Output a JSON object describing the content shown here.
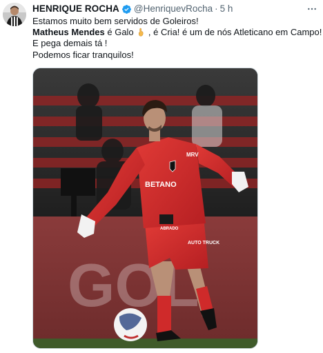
{
  "tweet": {
    "author_name": "HENRIQUE ROCHA",
    "handle": "@HenriquevRocha",
    "separator": "·",
    "time": "5 h",
    "more_label": "···",
    "text": {
      "line1": "Estamos muito bem servidos de Goleiros!",
      "line2_bold": "Matheus Mendes",
      "line2_a": " é Galo ",
      "line2_b": " , é Cria! é um de nós Atleticano em Campo!",
      "line3": "E pega demais tá !",
      "line4": "Podemos ficar tranquilos!"
    },
    "media": {
      "jersey_sponsor": "BETANO",
      "sleeve_sponsor": "MRV",
      "shorts_text": "AUTO TRUCK",
      "board_text": "GOL",
      "small_badge": "ABRADO"
    },
    "colors": {
      "verified": "#1d9bf0",
      "secondary_text": "#536471",
      "kit_red": "#d92b2b"
    }
  }
}
